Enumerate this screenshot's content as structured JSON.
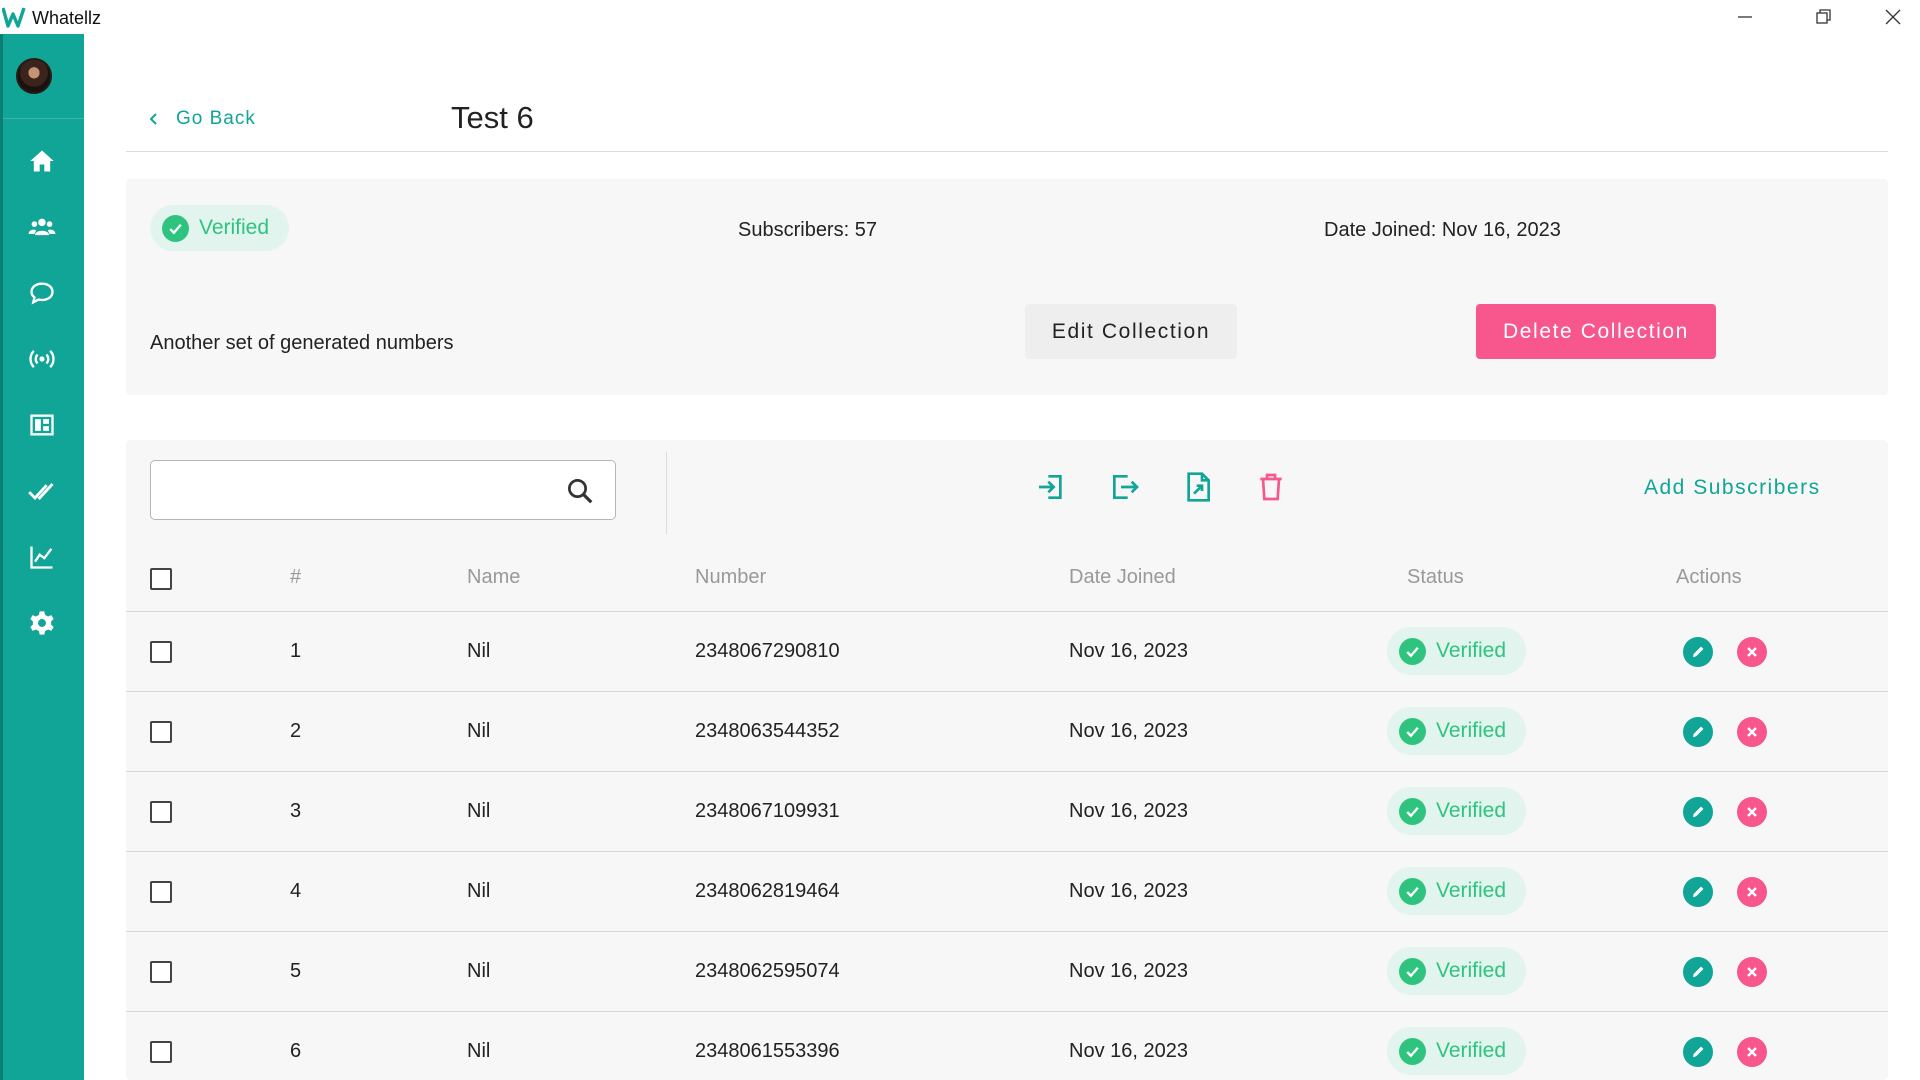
{
  "window": {
    "app_name": "Whatellz",
    "controls": [
      "minimize-icon",
      "restore-icon",
      "close-icon"
    ]
  },
  "sidebar": {
    "items": [
      {
        "icon": "home-icon"
      },
      {
        "icon": "users-icon"
      },
      {
        "icon": "chat-icon"
      },
      {
        "icon": "broadcast-icon"
      },
      {
        "icon": "dashboard-icon"
      },
      {
        "icon": "double-check-icon"
      },
      {
        "icon": "analytics-icon"
      },
      {
        "icon": "settings-icon"
      }
    ]
  },
  "header": {
    "back_label": "Go Back",
    "title": "Test 6"
  },
  "collection": {
    "status": "Verified",
    "subscribers": "Subscribers: 57",
    "date_joined": "Date Joined: Nov 16, 2023",
    "description": "Another set of generated numbers",
    "edit_label": "Edit Collection",
    "delete_label": "Delete Collection"
  },
  "toolbar": {
    "search_placeholder": "",
    "tools": [
      "import-icon",
      "export-icon",
      "file-icon",
      "trash-icon"
    ],
    "add_label": "Add Subscribers"
  },
  "table": {
    "columns": [
      "#",
      "Name",
      "Number",
      "Date Joined",
      "Status",
      "Actions"
    ],
    "rows": [
      {
        "index": "1",
        "name": "Nil",
        "number": "2348067290810",
        "date": "Nov 16, 2023",
        "status": "Verified"
      },
      {
        "index": "2",
        "name": "Nil",
        "number": "2348063544352",
        "date": "Nov 16, 2023",
        "status": "Verified"
      },
      {
        "index": "3",
        "name": "Nil",
        "number": "2348067109931",
        "date": "Nov 16, 2023",
        "status": "Verified"
      },
      {
        "index": "4",
        "name": "Nil",
        "number": "2348062819464",
        "date": "Nov 16, 2023",
        "status": "Verified"
      },
      {
        "index": "5",
        "name": "Nil",
        "number": "2348062595074",
        "date": "Nov 16, 2023",
        "status": "Verified"
      },
      {
        "index": "6",
        "name": "Nil",
        "number": "2348061553396",
        "date": "Nov 16, 2023",
        "status": "Verified"
      }
    ]
  },
  "colors": {
    "brand": "#10a596",
    "danger": "#f7578c",
    "verified": "#2ec47f",
    "verified_bg": "#e2f4ee"
  }
}
